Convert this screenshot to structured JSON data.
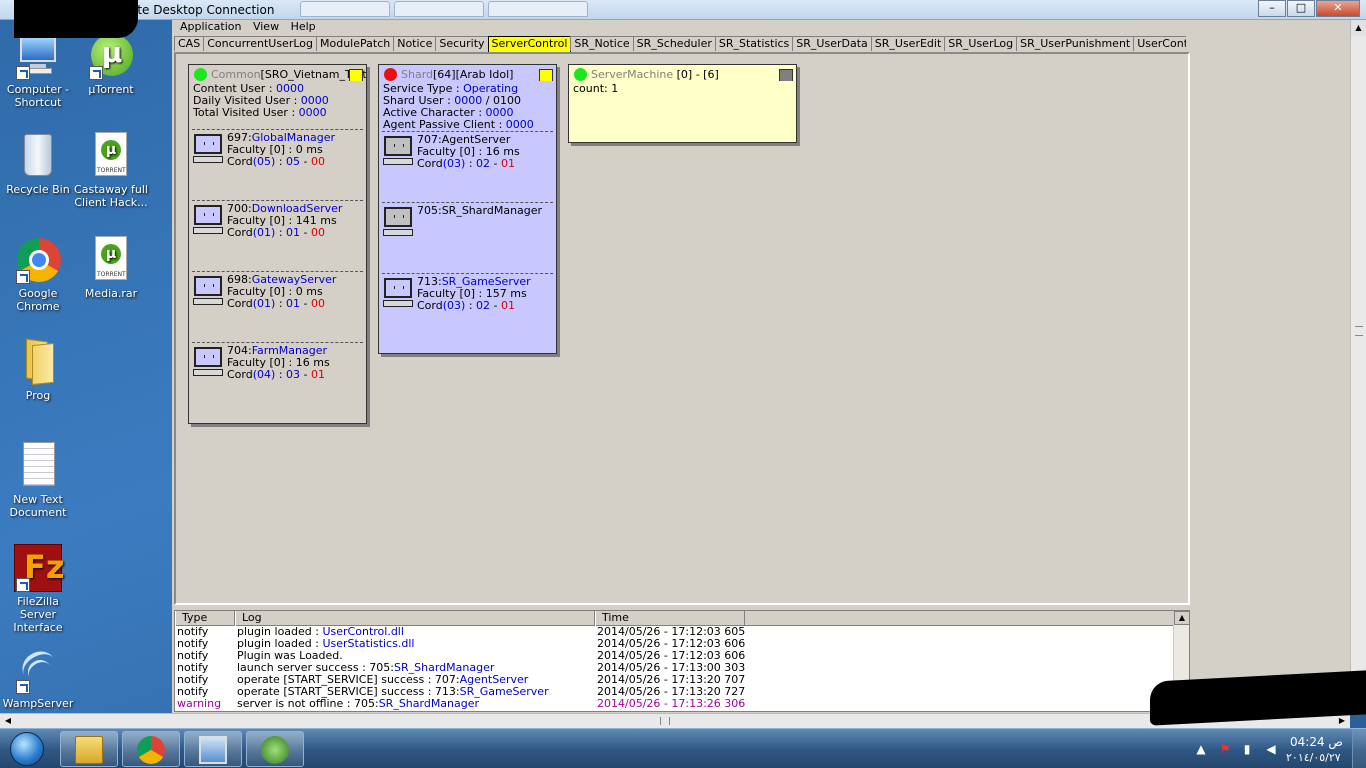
{
  "window": {
    "title": "ote Desktop Connection",
    "min": "–",
    "max": "□",
    "close": "✕"
  },
  "menu": [
    "Application",
    "View",
    "Help"
  ],
  "tabs": [
    "CAS",
    "ConcurrentUserLog",
    "ModulePatch",
    "Notice",
    "Security",
    "ServerControl",
    "SR_Notice",
    "SR_Scheduler",
    "SR_Statistics",
    "SR_UserData",
    "SR_UserEdit",
    "SR_UserLog",
    "SR_UserPunishment",
    "UserControl",
    "U"
  ],
  "active_tab": "ServerControl",
  "desktop_icons": [
    {
      "label": "Computer - Shortcut",
      "icon": "computer-icon"
    },
    {
      "label": "µTorrent",
      "icon": "utorrent-icon"
    },
    {
      "label": "Recycle Bin",
      "icon": "recycle-bin-icon"
    },
    {
      "label": "Castaway full Client Hack...",
      "icon": "torrent-file-icon"
    },
    {
      "label": "Google Chrome",
      "icon": "chrome-icon"
    },
    {
      "label": "Media.rar",
      "icon": "torrent-file-icon"
    },
    {
      "label": "Prog",
      "icon": "folder-icon"
    },
    {
      "label": "New Text Document",
      "icon": "text-file-icon"
    },
    {
      "label": "FileZilla Server Interface",
      "icon": "filezilla-icon"
    },
    {
      "label": "WampServer",
      "icon": "wampserver-icon"
    }
  ],
  "common": {
    "label": "Common",
    "name": "[SRO_Vietnam_TestL",
    "content_user_label": "Content User : ",
    "content_user": "0000",
    "daily_label": "Daily Visited User : ",
    "daily": "0000",
    "total_label": "Total Visited User : ",
    "total": "0000",
    "status_color": "#1ee61e",
    "services": [
      {
        "id": "697:",
        "name": "GlobalManager",
        "faculty": "Faculty [0] : 0 ms",
        "cord_a": "(05)",
        "cord_b": "05",
        "cord_c": "00"
      },
      {
        "id": "700:",
        "name": "DownloadServer",
        "faculty": "Faculty [0] : 141 ms",
        "cord_a": "(01)",
        "cord_b": "01",
        "cord_c": "00"
      },
      {
        "id": "698:",
        "name": "GatewayServer",
        "faculty": "Faculty [0] : 0 ms",
        "cord_a": "(01)",
        "cord_b": "01",
        "cord_c": "00"
      },
      {
        "id": "704:",
        "name": "FarmManager",
        "faculty": "Faculty [0] : 16 ms",
        "cord_a": "(04)",
        "cord_b": "03",
        "cord_c": "01"
      }
    ]
  },
  "shard": {
    "label": "Shard",
    "name": "[64][Arab Idol]",
    "service_type_label": "Service Type : ",
    "service_type": "Operating",
    "shard_user_label": "Shard User : ",
    "shard_user": "0000",
    "shard_user_max": " / 0100",
    "active_char_label": "Active Character : ",
    "active_char": "0000",
    "agent_passive_label": "Agent Passive Client : ",
    "agent_passive": "0000",
    "status_color": "#e81010",
    "services": [
      {
        "id": "707:",
        "name": "AgentServer",
        "faculty": "Faculty [0] : 16 ms",
        "cord_a": "(03)",
        "cord_b": "02",
        "cord_c": "01"
      },
      {
        "id": "705:",
        "name": "SR_ShardManager"
      },
      {
        "id": "713:",
        "name": "SR_GameServer",
        "faculty": "Faculty [0] : 157 ms",
        "cord_a": "(03)",
        "cord_b": "02",
        "cord_c": "01"
      }
    ]
  },
  "machine": {
    "label": "ServerMachine",
    "range": " [0] - [6]",
    "count": "count: 1",
    "status_color": "#1ee61e"
  },
  "log": {
    "headers": [
      "Type",
      "Log",
      "Time"
    ],
    "rows": [
      {
        "type": "notify",
        "msg": "plugin loaded : ",
        "link": "UserControl.dll",
        "time": "2014/05/26 - 17:12:03 605"
      },
      {
        "type": "notify",
        "msg": "plugin loaded : ",
        "link": "UserStatistics.dll",
        "time": "2014/05/26 - 17:12:03 606"
      },
      {
        "type": "notify",
        "msg": "Plugin was Loaded.",
        "link": "",
        "time": "2014/05/26 - 17:12:03 606"
      },
      {
        "type": "notify",
        "msg": "launch server success : 705:",
        "link": "SR_ShardManager",
        "time": "2014/05/26 - 17:13:00 303"
      },
      {
        "type": "notify",
        "msg": "operate [START_SERVICE] success : 707:",
        "link": "AgentServer",
        "time": "2014/05/26 - 17:13:20 707"
      },
      {
        "type": "notify",
        "msg": "operate [START_SERVICE] success : 713:",
        "link": "SR_GameServer",
        "time": "2014/05/26 - 17:13:20 727"
      },
      {
        "type": "warning",
        "msg": "server is not offline : 705:",
        "link": "SR_ShardManager",
        "time": "2014/05/26 - 17:13:26 306"
      }
    ]
  },
  "tray": {
    "time": "04:24 ص",
    "date": "٢٠١٤/٠٥/٢٧"
  }
}
